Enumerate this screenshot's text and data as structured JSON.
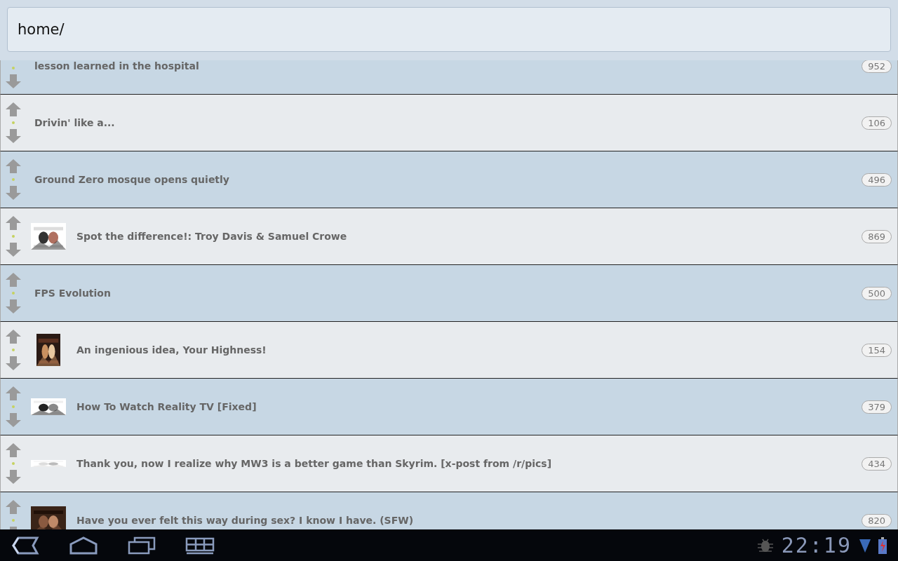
{
  "address_bar": {
    "value": "home/"
  },
  "posts": [
    {
      "title": "lesson learned in the hospital",
      "score": "952",
      "thumbnail": false
    },
    {
      "title": "Drivin' like a...",
      "score": "106",
      "thumbnail": false
    },
    {
      "title": "Ground Zero mosque opens quietly",
      "score": "496",
      "thumbnail": false
    },
    {
      "title": "Spot the difference!: Troy Davis & Samuel Crowe",
      "score": "869",
      "thumbnail": true
    },
    {
      "title": "FPS Evolution",
      "score": "500",
      "thumbnail": false
    },
    {
      "title": "An ingenious idea, Your Highness!",
      "score": "154",
      "thumbnail": true
    },
    {
      "title": "How To Watch Reality TV [Fixed]",
      "score": "379",
      "thumbnail": true
    },
    {
      "title": "Thank you, now I realize why MW3 is a better game than Skyrim. [x-post from /r/pics]",
      "score": "434",
      "thumbnail": true
    },
    {
      "title": "Have you ever felt this way during sex? I know I have. (SFW)",
      "score": "820",
      "thumbnail": true
    }
  ],
  "system_bar": {
    "clock": "22:19"
  }
}
